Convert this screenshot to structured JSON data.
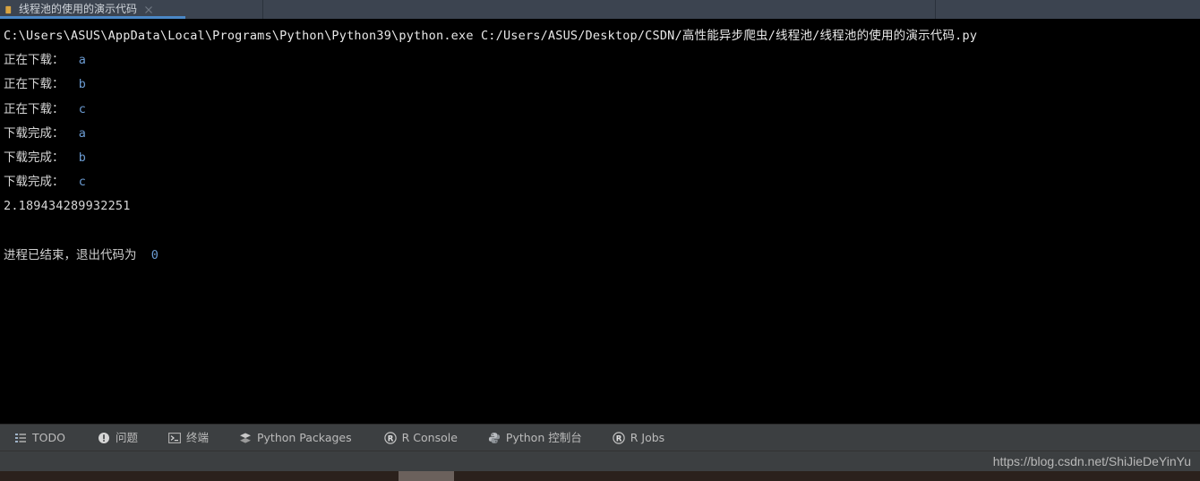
{
  "editor_tab": {
    "label": "线程池的使用的演示代码",
    "run_icon": "run-play-icon",
    "close_icon": "close-icon"
  },
  "console": {
    "command_line": "C:\\Users\\ASUS\\AppData\\Local\\Programs\\Python\\Python39\\python.exe C:/Users/ASUS/Desktop/CSDN/高性能异步爬虫/线程池/线程池的使用的演示代码.py",
    "output_lines": [
      {
        "label": "正在下载：",
        "value": "a"
      },
      {
        "label": "正在下载：",
        "value": "b"
      },
      {
        "label": "正在下载：",
        "value": "c"
      },
      {
        "label": "下载完成：",
        "value": "a"
      },
      {
        "label": "下载完成：",
        "value": "b"
      },
      {
        "label": "下载完成：",
        "value": "c"
      }
    ],
    "elapsed": "2.189434289932251",
    "exit_text": "进程已结束，退出代码为",
    "exit_code": "0"
  },
  "toolbar": {
    "items": [
      {
        "label": "TODO",
        "icon": "todo-list-icon"
      },
      {
        "label": "问题",
        "icon": "problems-warning-icon"
      },
      {
        "label": "终端",
        "icon": "terminal-icon"
      },
      {
        "label": "Python Packages",
        "icon": "packages-layers-icon"
      },
      {
        "label": "R Console",
        "icon": "r-console-icon"
      },
      {
        "label": "Python 控制台",
        "icon": "python-logo-icon"
      },
      {
        "label": "R Jobs",
        "icon": "r-jobs-icon"
      }
    ]
  },
  "status": {
    "watermark": "https://blog.csdn.net/ShiJieDeYinYu"
  },
  "colors": {
    "tab_accent": "#4a88c7",
    "tab_bar_bg": "#3c4450",
    "console_bg": "#000000",
    "toolbar_bg": "#3c3f41",
    "output_value": "#6b9bd2"
  }
}
